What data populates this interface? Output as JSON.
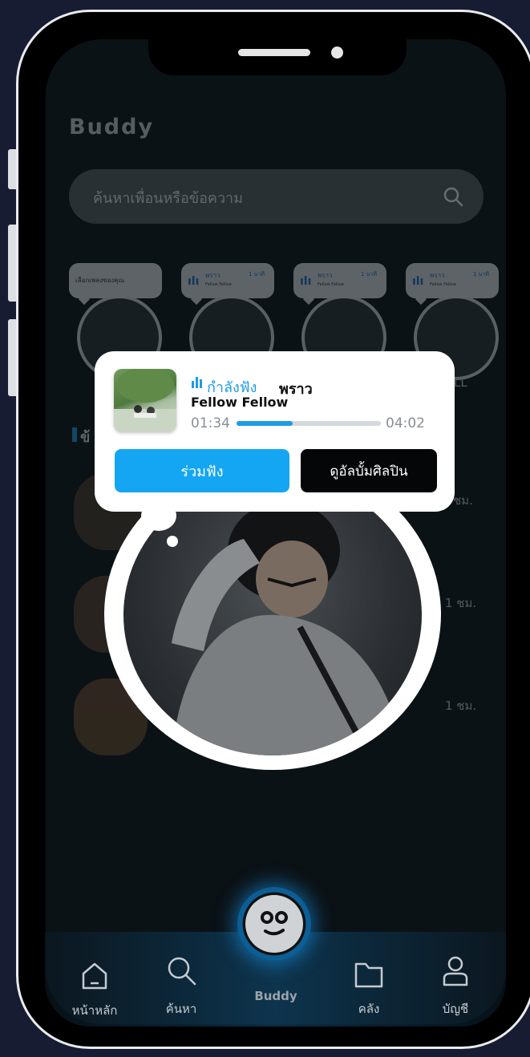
{
  "app": {
    "title": "Buddy"
  },
  "search": {
    "placeholder": "ค้นหาเพื่อนหรือข้อความ"
  },
  "stories": [
    {
      "prompt": "เลือกเพลงของคุณ"
    },
    {
      "song": "พราว",
      "artist": "Fellow Fellow",
      "time": "1 นาที"
    },
    {
      "song": "พราว",
      "artist": "Fellow Fellow",
      "time": "1 นาที"
    },
    {
      "song": "พราว",
      "artist": "Fellow Fellow",
      "time": "1 นาที"
    }
  ],
  "story_partial_label": "LL",
  "feed": {
    "section_prefix": "ข้",
    "times": [
      "ชม.",
      "1 ชม.",
      "1 ชม."
    ]
  },
  "now_playing": {
    "status_label": "กำลังฟัง",
    "song_title": "พราว",
    "artist": "Fellow Fellow",
    "current_time": "01:34",
    "total_time": "04:02",
    "progress": 0.39,
    "join_button": "ร่วมฟัง",
    "album_button": "ดูอัลบั้มศิลปิน"
  },
  "nav": {
    "items": [
      {
        "label": "หน้าหลัก",
        "icon": "home-icon"
      },
      {
        "label": "ค้นหา",
        "icon": "search-icon"
      },
      {
        "label": "Buddy",
        "icon": "buddy-icon"
      },
      {
        "label": "คลัง",
        "icon": "folder-icon"
      },
      {
        "label": "บัญชี",
        "icon": "account-icon"
      }
    ]
  },
  "colors": {
    "accent": "#14a6f2",
    "background": "#171c33",
    "dark_button": "#050607"
  }
}
